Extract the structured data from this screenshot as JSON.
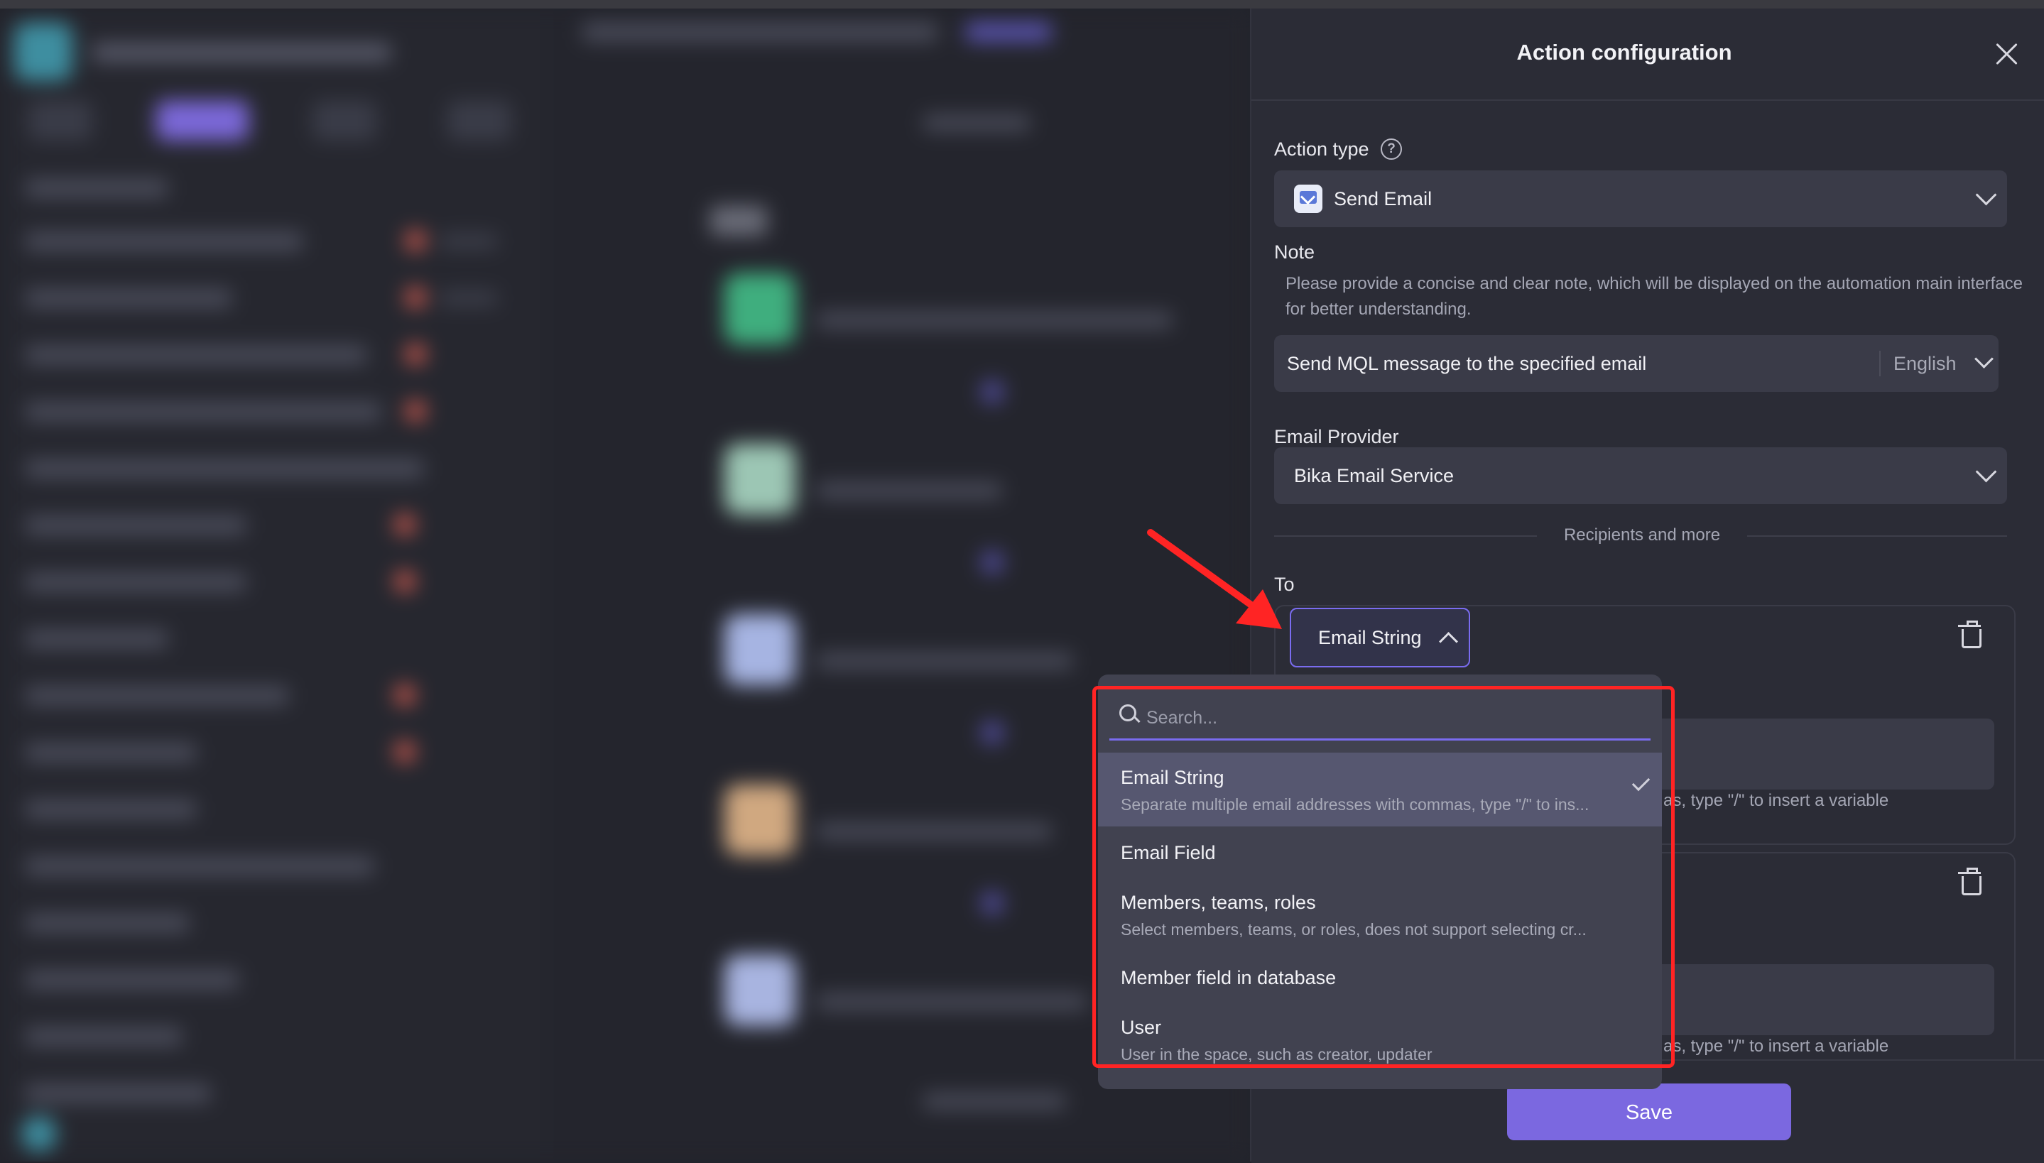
{
  "panel": {
    "title": "Action configuration",
    "action_type": {
      "label": "Action type",
      "help_icon": "?",
      "value": "Send Email",
      "icon": "email-icon"
    },
    "note": {
      "label": "Note",
      "description": "Please provide a concise and clear note, which will be displayed on the automation main interface for better understanding.",
      "value": "Send MQL message to the specified email",
      "language": "English"
    },
    "email_provider": {
      "label": "Email Provider",
      "value": "Bika Email Service"
    },
    "divider_label": "Recipients and more",
    "to": {
      "label": "To",
      "type_value": "Email String",
      "hint_1": "as, type \"/\" to insert a variable",
      "hint_2": "as, type \"/\" to insert a variable"
    },
    "save_label": "Save"
  },
  "dropdown": {
    "search_placeholder": "Search...",
    "items": [
      {
        "label": "Email String",
        "description": "Separate multiple email addresses with commas, type \"/\" to ins...",
        "selected": true
      },
      {
        "label": "Email Field",
        "description": "",
        "selected": false
      },
      {
        "label": "Members, teams, roles",
        "description": "Select members, teams, or roles, does not support selecting cr...",
        "selected": false
      },
      {
        "label": "Member field in database",
        "description": "",
        "selected": false
      },
      {
        "label": "User",
        "description": "User in the space, such as creator, updater",
        "selected": false
      }
    ]
  },
  "colors": {
    "accent": "#7b68e0",
    "panel_bg": "#2b2c36",
    "input_bg": "#3a3b48",
    "highlight": "#ff2424"
  }
}
